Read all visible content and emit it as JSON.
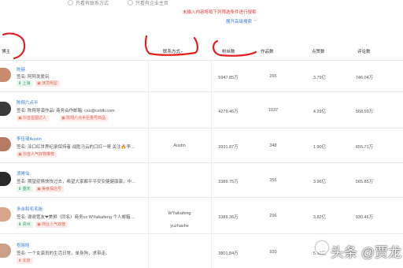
{
  "filters": {
    "option_a": "只看有联系方式",
    "option_b": "只看有企业主页"
  },
  "warning": "未输入内容将按下列筛选条件进行搜索",
  "advanced_search": "展开高级搜索",
  "columns": {
    "blogger": "博主",
    "contact": "联系方式",
    "followers": "粉丝数",
    "works": "作品数",
    "likes": "点赞数",
    "comments": "评论数"
  },
  "rows": [
    {
      "name": "陈赫",
      "signature": "签名: 阿阿发爱玩",
      "tags": [
        "上海",
        "演员明星"
      ],
      "contact": "",
      "followers": "5947.85万",
      "works": "265",
      "likes": "3.79亿",
      "comments": "746.04万",
      "avatar_color": "#c98b6b"
    },
    {
      "name": "陈翔六点半",
      "signature": "签名: 陈翔导演作品!   商务合作邮箱: cxx@cxldb.com",
      "tags": [
        "抖音星图达人",
        "陈翔六点半巨量号商品"
      ],
      "contact": "",
      "followers": "4279.46万",
      "works": "1037",
      "likes": "4.29亿",
      "comments": "568.59万",
      "avatar_color": "#3a3a3a"
    },
    {
      "name": "李佳琦Austin",
      "signature": "签名: 涂口红世界纪录保持者 战胜马云的口红一哥 关注🔥李…",
      "tags": [
        "抖音人气好物推荐"
      ],
      "contact": "Austin",
      "followers": "3931.87万",
      "works": "348",
      "likes": "1.90亿",
      "comments": "655.71万",
      "avatar_color": "#b57a62"
    },
    {
      "name": "浪胃仙",
      "signature": "签名: 期望疫情快快过去，希望大家都平平安安健健康康，中…",
      "tags": [
        "重庆",
        "美食探店号"
      ],
      "contact": "",
      "followers": "3389.75万",
      "works": "355",
      "likes": "3.96亿",
      "comments": "565.85万",
      "avatar_color": "#2a2a2a"
    },
    {
      "name": "多余和毛毛姐",
      "signature": "签名: 谢谢宽友❤美狮（同名）商务vx:WYaikafeng 个人邮箱…",
      "tags": [
        "贵州",
        "商业人气双榜"
      ],
      "contact": "WYaikafeng\nyuzhashe",
      "followers": "3389.36万",
      "works": "296",
      "likes": "3.82亿",
      "comments": "930.46万",
      "avatar_color": "#d7a58a"
    },
    {
      "name": "祝晓晗",
      "signature": "签名: 一个女演员的生活日常，单身狗，求带走。",
      "tags": [
        "北京"
      ],
      "contact": "",
      "followers": "3801.84万",
      "works": "920",
      "likes": "5.15亿",
      "comments": "",
      "avatar_color": "#caa08a"
    }
  ],
  "watermark": "头条 @贾龙"
}
